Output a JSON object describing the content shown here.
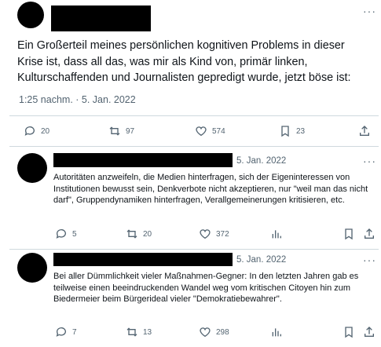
{
  "main_tweet": {
    "text": "Ein Großerteil meines persönlichen kognitiven Problems in dieser Krise ist, dass all das, was mir als Kind von, primär linken, Kulturschaffenden und Journalisten gepredigt wurde, jetzt böse ist:",
    "timestamp": "1:25 nachm. · 5. Jan. 2022",
    "more": "···",
    "stats": {
      "replies": "20",
      "retweets": "97",
      "likes": "574",
      "views": "23"
    }
  },
  "replies": [
    {
      "date": "5. Jan. 2022",
      "more": "···",
      "text": "Autoritäten anzweifeln, die Medien hinterfragen, sich der Eigeninteressen von Institutionen bewusst sein, Denkverbote nicht akzeptieren, nur \"weil man das nicht darf\", Gruppendynamiken hinterfragen, Verallgemeinerungen kritisieren, etc.",
      "stats": {
        "replies": "5",
        "retweets": "20",
        "likes": "372"
      }
    },
    {
      "date": "5. Jan. 2022",
      "more": "···",
      "text": "Bei aller Dümmlichkeit vieler Maßnahmen-Gegner: In den letzten Jahren gab es teilweise einen beeindruckenden Wandel weg vom kritischen Citoyen hin zum Biedermeier beim Bürgerideal vieler \"Demokratiebewahrer\".",
      "stats": {
        "replies": "7",
        "retweets": "13",
        "likes": "298"
      }
    }
  ]
}
